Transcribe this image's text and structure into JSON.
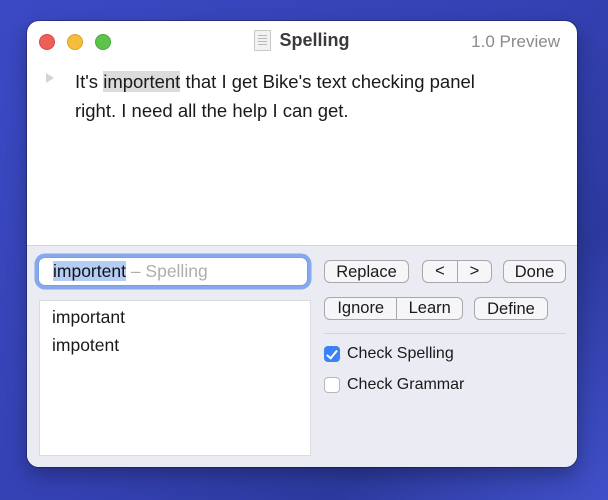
{
  "window": {
    "title": "Spelling",
    "subtitle": "1.0 Preview"
  },
  "editor": {
    "before": "It's ",
    "misspelled": "importent",
    "after": " that I get Bike's text checking panel right. I need all the help I can get."
  },
  "panel": {
    "word_field": {
      "value": "importent",
      "hint": " – Spelling"
    },
    "suggestions": [
      "important",
      "impotent"
    ],
    "buttons": {
      "replace": "Replace",
      "previous": "<",
      "next": ">",
      "done": "Done",
      "ignore": "Ignore",
      "learn": "Learn",
      "define": "Define"
    },
    "options": {
      "check_spelling": {
        "label": "Check Spelling",
        "checked": true
      },
      "check_grammar": {
        "label": "Check Grammar",
        "checked": false
      }
    }
  },
  "colors": {
    "accent": "#3b82f6",
    "focus_ring": "#86a8ec",
    "selection": "#b3cdf5",
    "desktop": "#3b4ac4"
  }
}
